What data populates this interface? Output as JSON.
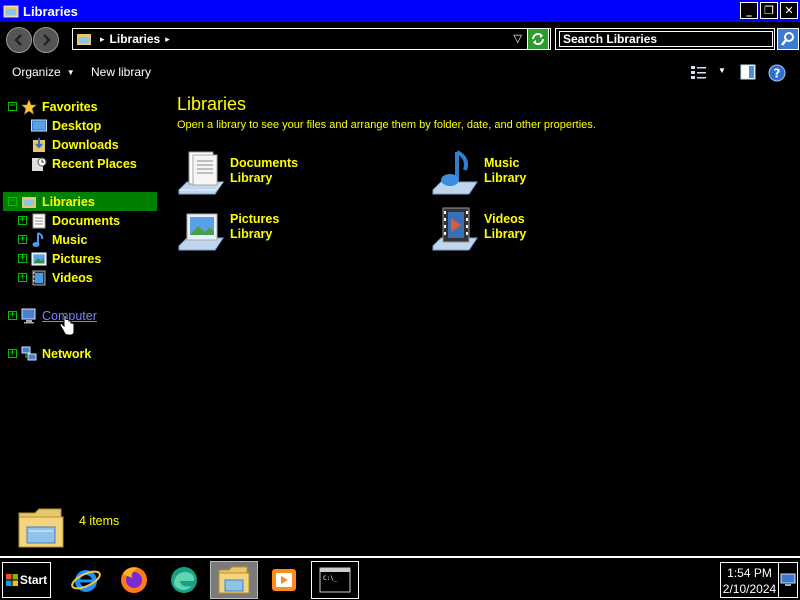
{
  "window": {
    "title": "Libraries",
    "buttons": {
      "minimize": "_",
      "maximize": "❐",
      "close": "✕"
    }
  },
  "address_bar": {
    "path": "Libraries",
    "search_placeholder": "Search Libraries"
  },
  "toolbar": {
    "organize_label": "Organize",
    "new_library_label": "New library"
  },
  "nav": {
    "favorites": {
      "label": "Favorites",
      "items": [
        "Desktop",
        "Downloads",
        "Recent Places"
      ]
    },
    "libraries": {
      "label": "Libraries",
      "items": [
        "Documents",
        "Music",
        "Pictures",
        "Videos"
      ]
    },
    "computer": "Computer",
    "network": "Network"
  },
  "content": {
    "title": "Libraries",
    "subtitle": "Open a library to see your files and arrange them by folder, date, and other properties.",
    "libraries": [
      {
        "name": "Documents",
        "sub": "Library",
        "icon": "documents-library-icon"
      },
      {
        "name": "Music",
        "sub": "Library",
        "icon": "music-library-icon"
      },
      {
        "name": "Pictures",
        "sub": "Library",
        "icon": "pictures-library-icon"
      },
      {
        "name": "Videos",
        "sub": "Library",
        "icon": "videos-library-icon"
      }
    ]
  },
  "details": {
    "count": "4 items"
  },
  "taskbar": {
    "start_label": "Start",
    "apps": [
      "internet-explorer-icon",
      "firefox-icon",
      "edge-icon",
      "file-explorer-icon",
      "media-player-icon",
      "command-prompt-icon"
    ],
    "time": "1:54 PM",
    "date": "2/10/2024"
  },
  "colors": {
    "titlebar": "#0000ff",
    "text_highlight": "#ffff00",
    "selection": "#008000",
    "link": "#8080ff",
    "background": "#000000"
  }
}
